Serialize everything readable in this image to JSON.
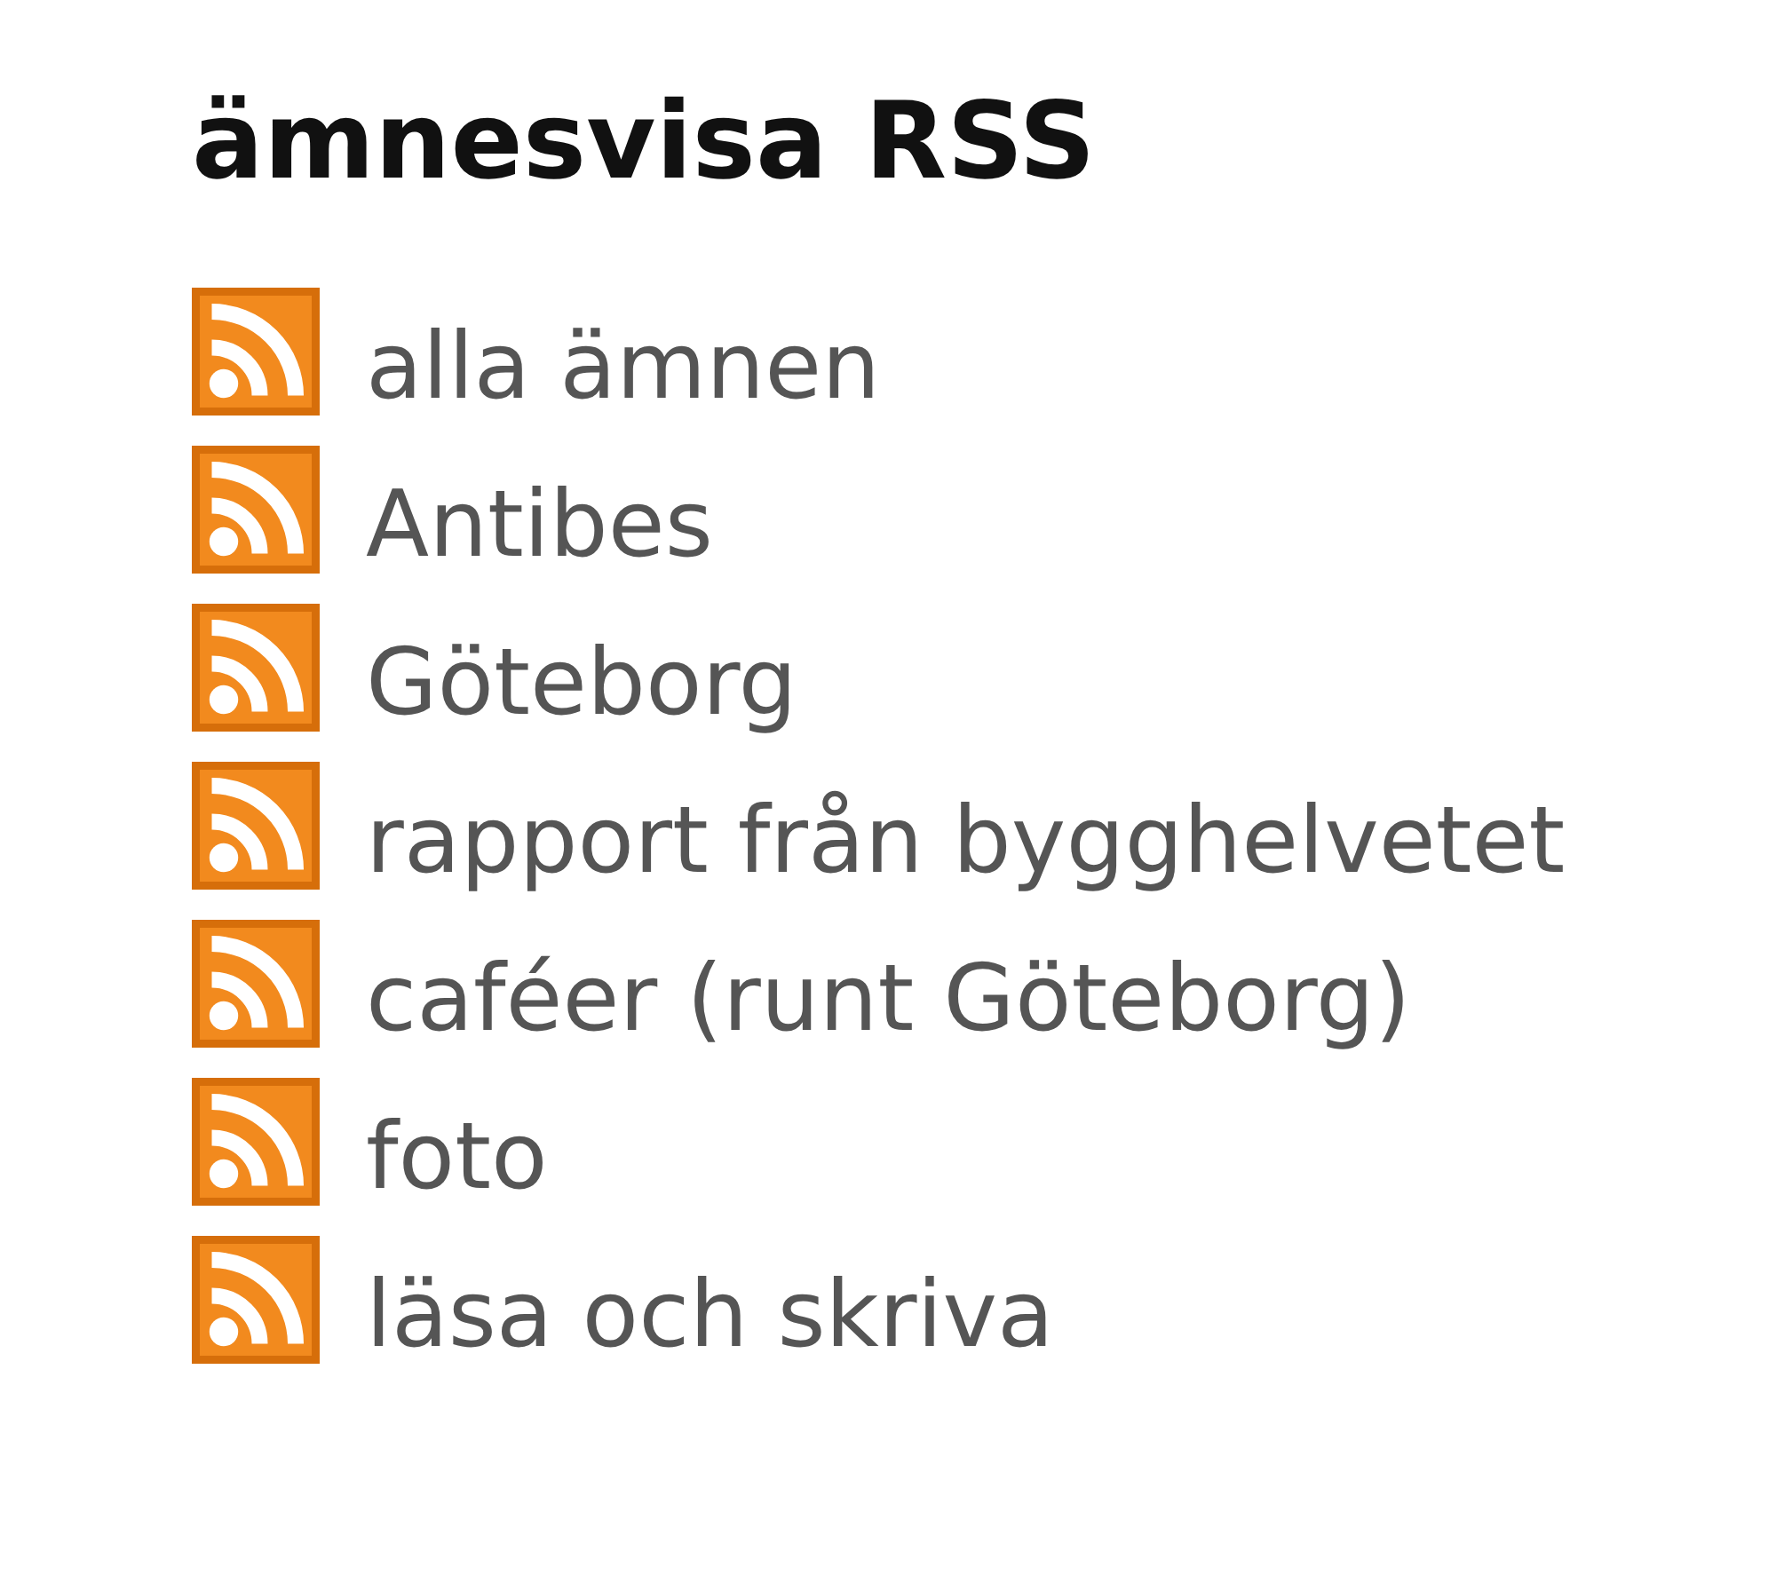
{
  "heading": "ämnesvisa RSS",
  "feeds": [
    {
      "label": "alla ämnen"
    },
    {
      "label": "Antibes"
    },
    {
      "label": "Göteborg"
    },
    {
      "label": "rapport från bygghelvetet"
    },
    {
      "label": "caféer (runt Göteborg)"
    },
    {
      "label": "foto"
    },
    {
      "label": "läsa och skriva"
    }
  ]
}
